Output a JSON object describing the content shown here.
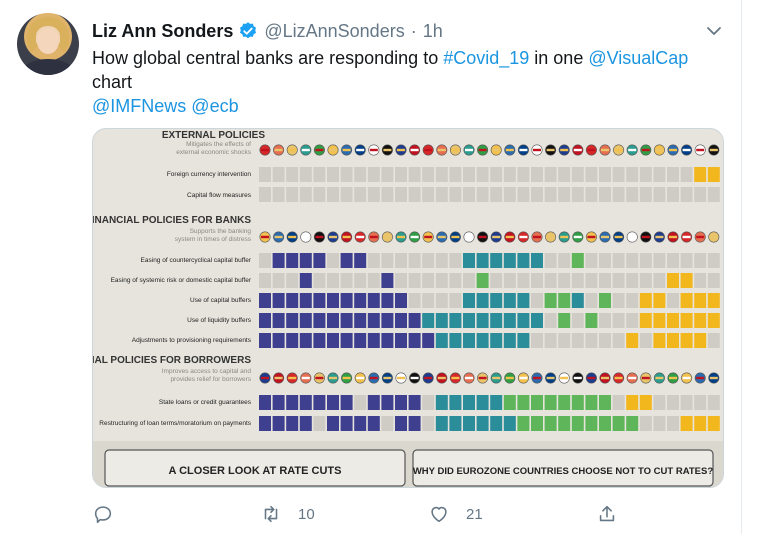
{
  "tweet": {
    "author_name": "Liz Ann Sonders",
    "handle": "@LizAnnSonders",
    "separator": "·",
    "time": "1h",
    "text_part1": "How global central banks are responding to ",
    "hashtag": "#Covid_19",
    "text_part2": " in one ",
    "mention_visualcap": "@VisualCap",
    "text_part3": "chart",
    "mention_imf": "@IMFNews",
    "mention_ecb": "@ecb",
    "link_color": "#1b95e0"
  },
  "actions": {
    "reply_icon": "reply-icon",
    "retweet_icon": "retweet-icon",
    "retweet_count": "10",
    "like_icon": "heart-icon",
    "like_count": "21",
    "share_icon": "share-icon"
  },
  "infographic": {
    "section1": {
      "title": "EXTERNAL POLICIES",
      "subtitle_line1": "Mitigates the effects of",
      "subtitle_line2": "external economic shocks",
      "rows": [
        "Foreign currency intervention",
        "Capital flow measures"
      ]
    },
    "section2": {
      "title": "FINANCIAL POLICIES FOR BANKS",
      "subtitle_line1": "Supports the banking",
      "subtitle_line2": "system in times of distress",
      "rows": [
        "Easing of countercyclical capital buffer",
        "Easing of systemic risk or domestic capital buffer",
        "Use of capital buffers",
        "Use of liquidity buffers",
        "Adjustments to provisioning requirements"
      ]
    },
    "section3": {
      "title": "FINANCIAL POLICIES FOR BORROWERS",
      "subtitle_line1": "Improves access to capital and",
      "subtitle_line2": "provides relief for borrowers",
      "rows": [
        "State loans or credit guarantees",
        "Restructuring of loan terms/moratorium on payments"
      ]
    },
    "bottom_left": "A CLOSER LOOK AT RATE CUTS",
    "bottom_right": "WHY DID EUROZONE COUNTRIES CHOOSE NOT TO CUT RATES?",
    "colors": {
      "navy": "#3f3f8f",
      "teal": "#2b8c9a",
      "green": "#5fb65a",
      "yellow": "#f3b71e",
      "empty": "#cfccc6",
      "background": "#e4e1da"
    }
  }
}
